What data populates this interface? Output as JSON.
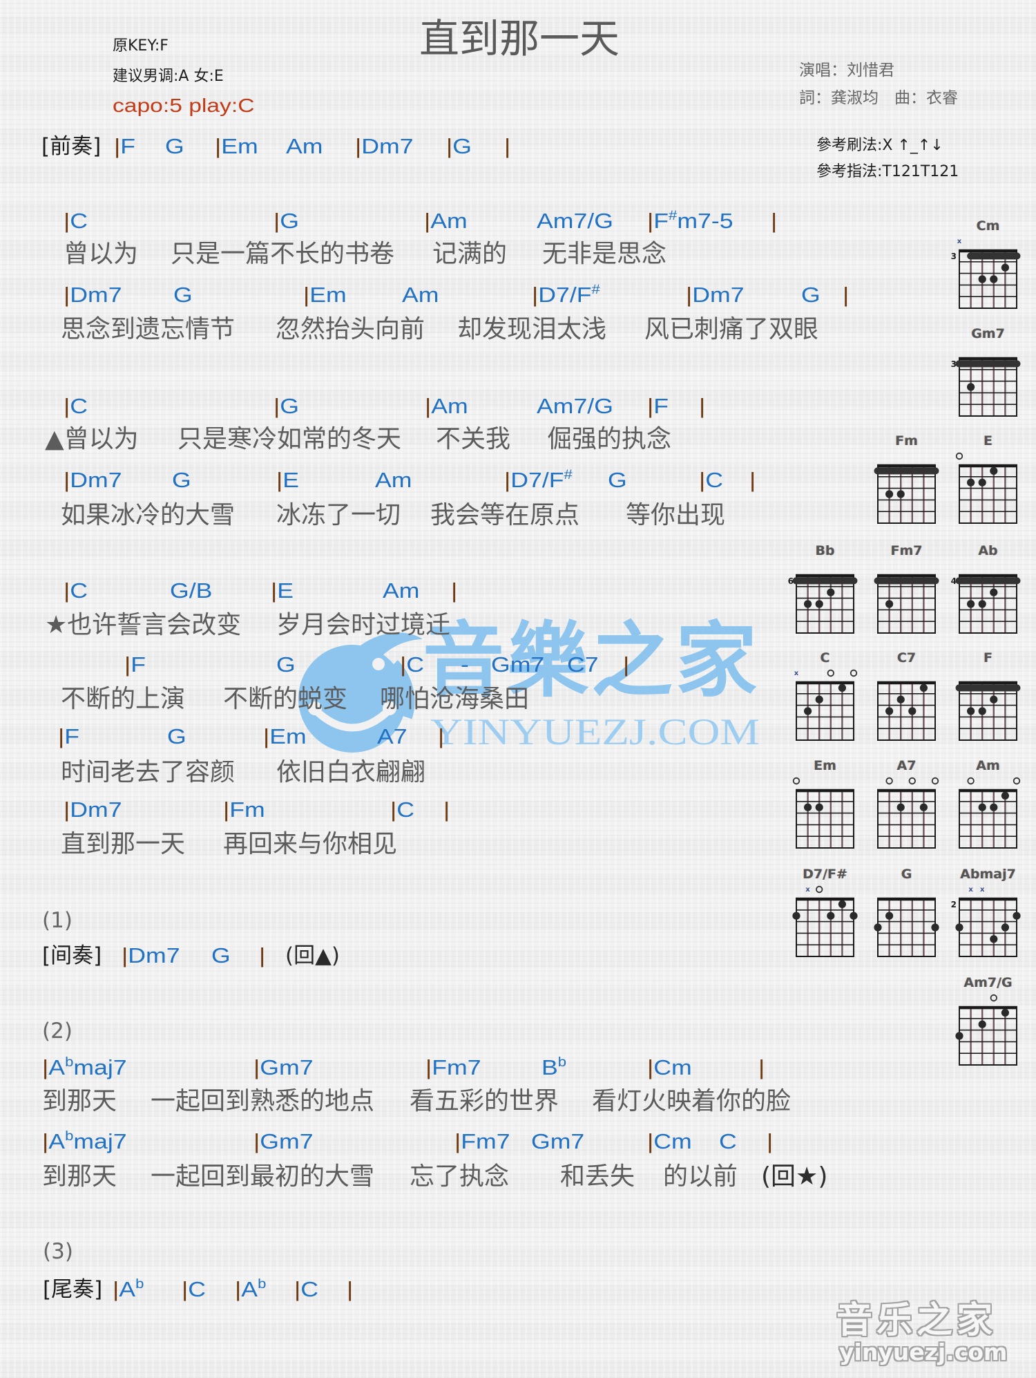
{
  "header": {
    "title": "直到那一天",
    "original_key": "原KEY:F",
    "suggested_key": "建议男调:A 女:E",
    "capo": "capo:5 play:C",
    "singer": "演唱：刘惜君",
    "credits": "詞：龚淑均　曲：衣睿",
    "strum": "參考刷法:X ↑_↑↓",
    "picking": "參考指法:T121T121"
  },
  "colors": {
    "chord": "#2171c4",
    "bar": "#6e3b12",
    "lyric": "#5c5c5c",
    "capo": "#c33a17",
    "label": "#1c1c1c",
    "watermark": "#8ec5ef"
  },
  "intro": {
    "label": "[前奏]",
    "chords": [
      "|F",
      "G",
      "|Em",
      "Am",
      "|Dm7",
      "|G",
      "|"
    ]
  },
  "verse_1": [
    {
      "chords": [
        "|C",
        "|G",
        "|Am",
        "Am7/G",
        "|F#m7-5",
        "|"
      ],
      "lyrics": [
        "曾以为",
        "只是一篇不长的书卷",
        "记满的",
        "无非是思念"
      ]
    },
    {
      "chords": [
        "|Dm7",
        "G",
        "|Em",
        "Am",
        "|D7/F#",
        "|Dm7",
        "G",
        "|"
      ],
      "lyrics": [
        "思念到遗忘情节",
        "忽然抬头向前",
        "却发现泪太浅",
        "风已刺痛了双眼"
      ]
    }
  ],
  "verse_2": [
    {
      "chords": [
        "|C",
        "|G",
        "|Am",
        "Am7/G",
        "|F",
        "|"
      ],
      "lyrics": [
        "▲曾以为",
        "只是寒冷如常的冬天",
        "不关我",
        "倔强的执念"
      ]
    },
    {
      "chords": [
        "|Dm7",
        "G",
        "|E",
        "Am",
        "|D7/F#",
        "G",
        "|C",
        "|"
      ],
      "lyrics": [
        "如果冰冷的大雪",
        "冰冻了一切",
        "我会等在原点",
        "等你出现"
      ]
    }
  ],
  "chorus": [
    {
      "chords": [
        "|C",
        "G/B",
        "|E",
        "Am",
        "|"
      ],
      "lyrics": [
        "★也许誓言会改变",
        "岁月会时过境迁"
      ]
    },
    {
      "chords": [
        "|F",
        "G",
        "|C",
        "-",
        "Gm7",
        "C7",
        "|"
      ],
      "lyrics": [
        "不断的上演",
        "不断的蜕变",
        "哪怕沧海桑田"
      ]
    },
    {
      "chords": [
        "|F",
        "G",
        "|Em",
        "A7",
        "|"
      ],
      "lyrics": [
        "时间老去了容颜",
        "依旧白衣翩翩"
      ]
    },
    {
      "chords": [
        "|Dm7",
        "|Fm",
        "|C",
        "|"
      ],
      "lyrics": [
        "直到那一天",
        "再回来与你相见"
      ]
    }
  ],
  "part_1": {
    "marker": "(1)",
    "interlude": {
      "label": "[间奏]",
      "chords": [
        "|Dm7",
        "G",
        "|"
      ],
      "note": "(回▲)"
    }
  },
  "part_2": {
    "marker": "(2)",
    "lines": [
      {
        "chords": [
          "|Abmaj7",
          "|Gm7",
          "|Fm7",
          "Bb",
          "|Cm",
          "|"
        ],
        "lyrics": [
          "到那天",
          "一起回到熟悉的地点",
          "看五彩的世界",
          "看灯火映着你的脸"
        ]
      },
      {
        "chords": [
          "|Abmaj7",
          "|Gm7",
          "|Fm7",
          "Gm7",
          "|Cm",
          "C",
          "|"
        ],
        "lyrics": [
          "到那天",
          "一起回到最初的大雪",
          "忘了执念",
          "和丢失",
          "的以前",
          "(回★)"
        ]
      }
    ]
  },
  "part_3": {
    "marker": "(3)",
    "outro": {
      "label": "[尾奏]",
      "chords": [
        "|Ab",
        "|C",
        "|Ab",
        "|C",
        "|"
      ]
    }
  },
  "chord_diagrams": [
    {
      "name": "Cm",
      "base_fret": 3,
      "markers": [
        "x",
        null,
        null,
        null,
        null,
        null
      ],
      "barre": {
        "fret": 1,
        "from": 2,
        "to": 6
      },
      "dots": [
        [
          5,
          2
        ],
        [
          3,
          3
        ],
        [
          4,
          3
        ]
      ]
    },
    {
      "name": "Gm7",
      "base_fret": 3,
      "markers": [
        null,
        null,
        null,
        null,
        null,
        null
      ],
      "barre": {
        "fret": 1,
        "from": 1,
        "to": 6
      },
      "dots": [
        [
          2,
          3
        ]
      ]
    },
    {
      "name": "Fm",
      "base_fret": null,
      "markers": [
        null,
        null,
        null,
        null,
        null,
        null
      ],
      "barre": {
        "fret": 1,
        "from": 1,
        "to": 6
      },
      "dots": [
        [
          2,
          3
        ],
        [
          3,
          3
        ]
      ]
    },
    {
      "name": "E",
      "base_fret": null,
      "markers": [
        "o",
        null,
        null,
        null,
        null,
        null
      ],
      "barre": null,
      "dots": [
        [
          4,
          1
        ],
        [
          2,
          2
        ],
        [
          3,
          2
        ]
      ]
    },
    {
      "name": "Bb",
      "base_fret": 6,
      "markers": [
        null,
        null,
        null,
        null,
        null,
        null
      ],
      "barre": {
        "fret": 1,
        "from": 1,
        "to": 6
      },
      "dots": [
        [
          4,
          2
        ],
        [
          2,
          3
        ],
        [
          3,
          3
        ]
      ]
    },
    {
      "name": "Fm7",
      "base_fret": null,
      "markers": [
        null,
        null,
        null,
        null,
        null,
        null
      ],
      "barre": {
        "fret": 1,
        "from": 1,
        "to": 6
      },
      "dots": [
        [
          2,
          3
        ]
      ]
    },
    {
      "name": "Ab",
      "base_fret": 4,
      "markers": [
        null,
        null,
        null,
        null,
        null,
        null
      ],
      "barre": {
        "fret": 1,
        "from": 1,
        "to": 6
      },
      "dots": [
        [
          4,
          2
        ],
        [
          2,
          3
        ],
        [
          3,
          3
        ]
      ]
    },
    {
      "name": "C",
      "base_fret": null,
      "markers": [
        "x",
        null,
        null,
        "o",
        null,
        "o"
      ],
      "barre": null,
      "dots": [
        [
          5,
          1
        ],
        [
          3,
          2
        ],
        [
          2,
          3
        ]
      ]
    },
    {
      "name": "C7",
      "base_fret": null,
      "markers": [
        null,
        null,
        null,
        null,
        null,
        null
      ],
      "barre": null,
      "dots": [
        [
          5,
          1
        ],
        [
          3,
          2
        ],
        [
          2,
          3
        ],
        [
          4,
          3
        ]
      ]
    },
    {
      "name": "F",
      "base_fret": null,
      "markers": [
        null,
        null,
        null,
        null,
        null,
        null
      ],
      "barre": {
        "fret": 1,
        "from": 1,
        "to": 6
      },
      "dots": [
        [
          4,
          2
        ],
        [
          2,
          3
        ],
        [
          3,
          3
        ]
      ]
    },
    {
      "name": "Em",
      "base_fret": null,
      "markers": [
        "o",
        null,
        null,
        null,
        null,
        null
      ],
      "barre": null,
      "dots": [
        [
          2,
          2
        ],
        [
          3,
          2
        ]
      ]
    },
    {
      "name": "A7",
      "base_fret": null,
      "markers": [
        null,
        "o",
        null,
        "o",
        null,
        "o"
      ],
      "barre": null,
      "dots": [
        [
          3,
          2
        ],
        [
          5,
          2
        ]
      ]
    },
    {
      "name": "Am",
      "base_fret": null,
      "markers": [
        null,
        "o",
        null,
        null,
        null,
        "o"
      ],
      "barre": null,
      "dots": [
        [
          5,
          1
        ],
        [
          3,
          2
        ],
        [
          4,
          2
        ]
      ]
    },
    {
      "name": "D7/F#",
      "base_fret": null,
      "markers": [
        null,
        "x",
        "o",
        null,
        null,
        null
      ],
      "barre": null,
      "dots": [
        [
          5,
          1
        ],
        [
          1,
          2
        ],
        [
          4,
          2
        ],
        [
          6,
          2
        ]
      ]
    },
    {
      "name": "G",
      "base_fret": null,
      "markers": [
        null,
        null,
        null,
        null,
        null,
        null
      ],
      "barre": null,
      "dots": [
        [
          2,
          2
        ],
        [
          1,
          3
        ],
        [
          6,
          3
        ]
      ]
    },
    {
      "name": "Abmaj7",
      "base_fret": 2,
      "markers": [
        null,
        "x",
        "x",
        null,
        null,
        null
      ],
      "barre": null,
      "dots": [
        [
          6,
          2
        ],
        [
          1,
          3
        ],
        [
          5,
          3
        ],
        [
          4,
          4
        ]
      ]
    },
    {
      "name": "Am7/G",
      "base_fret": null,
      "markers": [
        null,
        null,
        null,
        "o",
        null,
        null
      ],
      "barre": null,
      "dots": [
        [
          5,
          1
        ],
        [
          3,
          2
        ],
        [
          1,
          3
        ]
      ]
    }
  ],
  "watermark": {
    "text_cn": "音樂之家",
    "text_en": "YINYUEZJ.COM"
  },
  "footer_logo": {
    "text_cn": "音乐之家",
    "text_en": "yinyuezj.com"
  }
}
